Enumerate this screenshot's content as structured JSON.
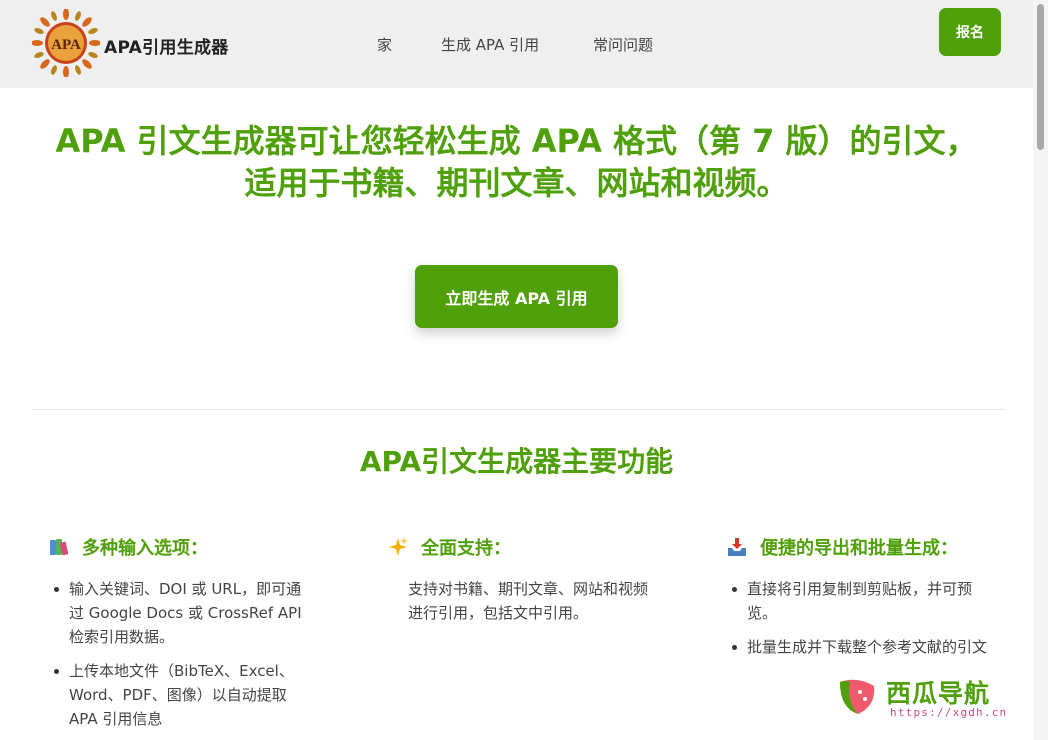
{
  "header": {
    "logo_text": "APA",
    "brand": "APA引用生成器",
    "nav": [
      "家",
      "生成 APA 引用",
      "常问问题"
    ],
    "signup_label": "报名"
  },
  "hero": {
    "line1": "APA 引文生成器可让您轻松生成 APA 格式（第 7 版）的引文，",
    "line2": "适用于书籍、期刊文章、网站和视频。",
    "cta_label": "立即生成 APA 引用"
  },
  "features_section": {
    "title": "APA引文生成器主要功能",
    "features": [
      {
        "icon": "books-icon",
        "title": "多种输入选项：",
        "items": [
          "输入关键词、DOI 或 URL，即可通过 Google Docs 或 CrossRef API 检索引用数据。",
          "上传本地文件（BibTeX、Excel、Word、PDF、图像）以自动提取 APA 引用信息"
        ]
      },
      {
        "icon": "sparkles-icon",
        "title": "全面支持：",
        "text": "支持对书籍、期刊文章、网站和视频进行引用，包括文中引用。"
      },
      {
        "icon": "inbox-tray-icon",
        "title": "便捷的导出和批量生成：",
        "items": [
          "直接将引用复制到剪贴板，并可预览。",
          "批量生成并下载整个参考文献的引文"
        ]
      }
    ]
  },
  "watermark": {
    "text": "西瓜导航",
    "url": "https://xgdh.cn"
  },
  "colors": {
    "accent": "#4fa00a",
    "header_bg": "#efefef",
    "watermark_url": "#d24a80"
  }
}
